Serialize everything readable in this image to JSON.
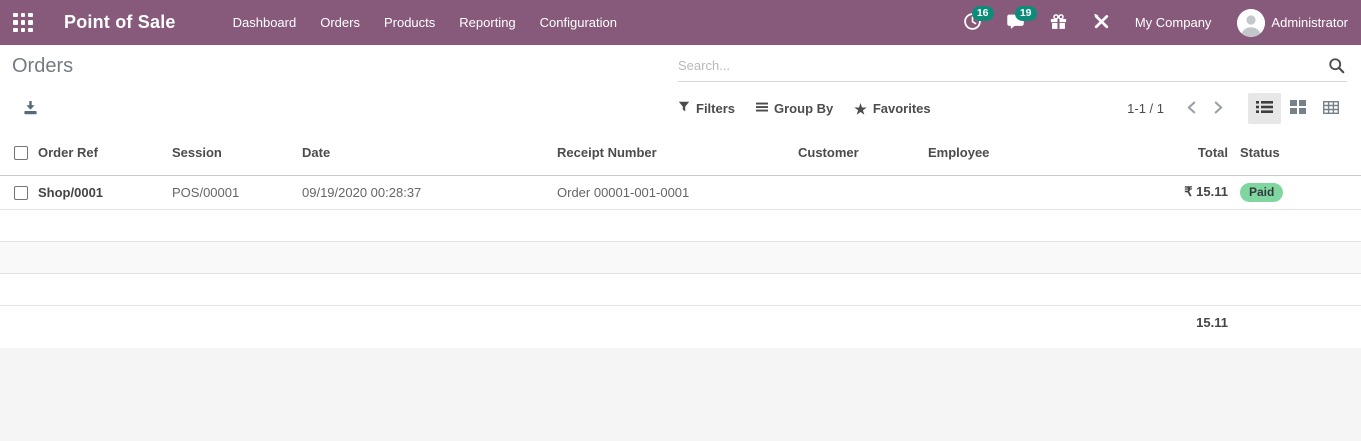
{
  "navbar": {
    "app_title": "Point of Sale",
    "menu": [
      "Dashboard",
      "Orders",
      "Products",
      "Reporting",
      "Configuration"
    ],
    "activity_badge": "16",
    "message_badge": "19",
    "company": "My Company",
    "user": "Administrator"
  },
  "control_panel": {
    "title": "Orders",
    "search_placeholder": "Search...",
    "filters_label": "Filters",
    "group_by_label": "Group By",
    "favorites_label": "Favorites",
    "pager_value": "1-1 / 1"
  },
  "table": {
    "columns": [
      "Order Ref",
      "Session",
      "Date",
      "Receipt Number",
      "Customer",
      "Employee",
      "Total",
      "Status"
    ],
    "rows": [
      {
        "order_ref": "Shop/0001",
        "session": "POS/00001",
        "date": "09/19/2020 00:28:37",
        "receipt_number": "Order 00001-001-0001",
        "customer": "",
        "employee": "",
        "total": "₹ 15.11",
        "status": "Paid"
      }
    ],
    "footer_total": "15.11"
  },
  "icons": {
    "apps_menu": "3x3-grid",
    "activity": "clock",
    "messages": "chat-bubble",
    "gift": "gift-box",
    "tools": "crossed-tools",
    "search": "magnifier",
    "export": "download-arrow",
    "filters": "funnel",
    "group_by": "triple-bars",
    "favorites": "star",
    "view_list": "list-bullets",
    "view_kanban": "kanban-squares",
    "view_pivot": "grid-table",
    "pager_prev": "chevron-left",
    "pager_next": "chevron-right"
  },
  "colors": {
    "navbar_bg": "#875A7B",
    "badge_teal": "#0d8c7a",
    "paid_badge_bg": "#7fd69e",
    "header_text": "#4c4c4c",
    "body_text": "#666666"
  }
}
